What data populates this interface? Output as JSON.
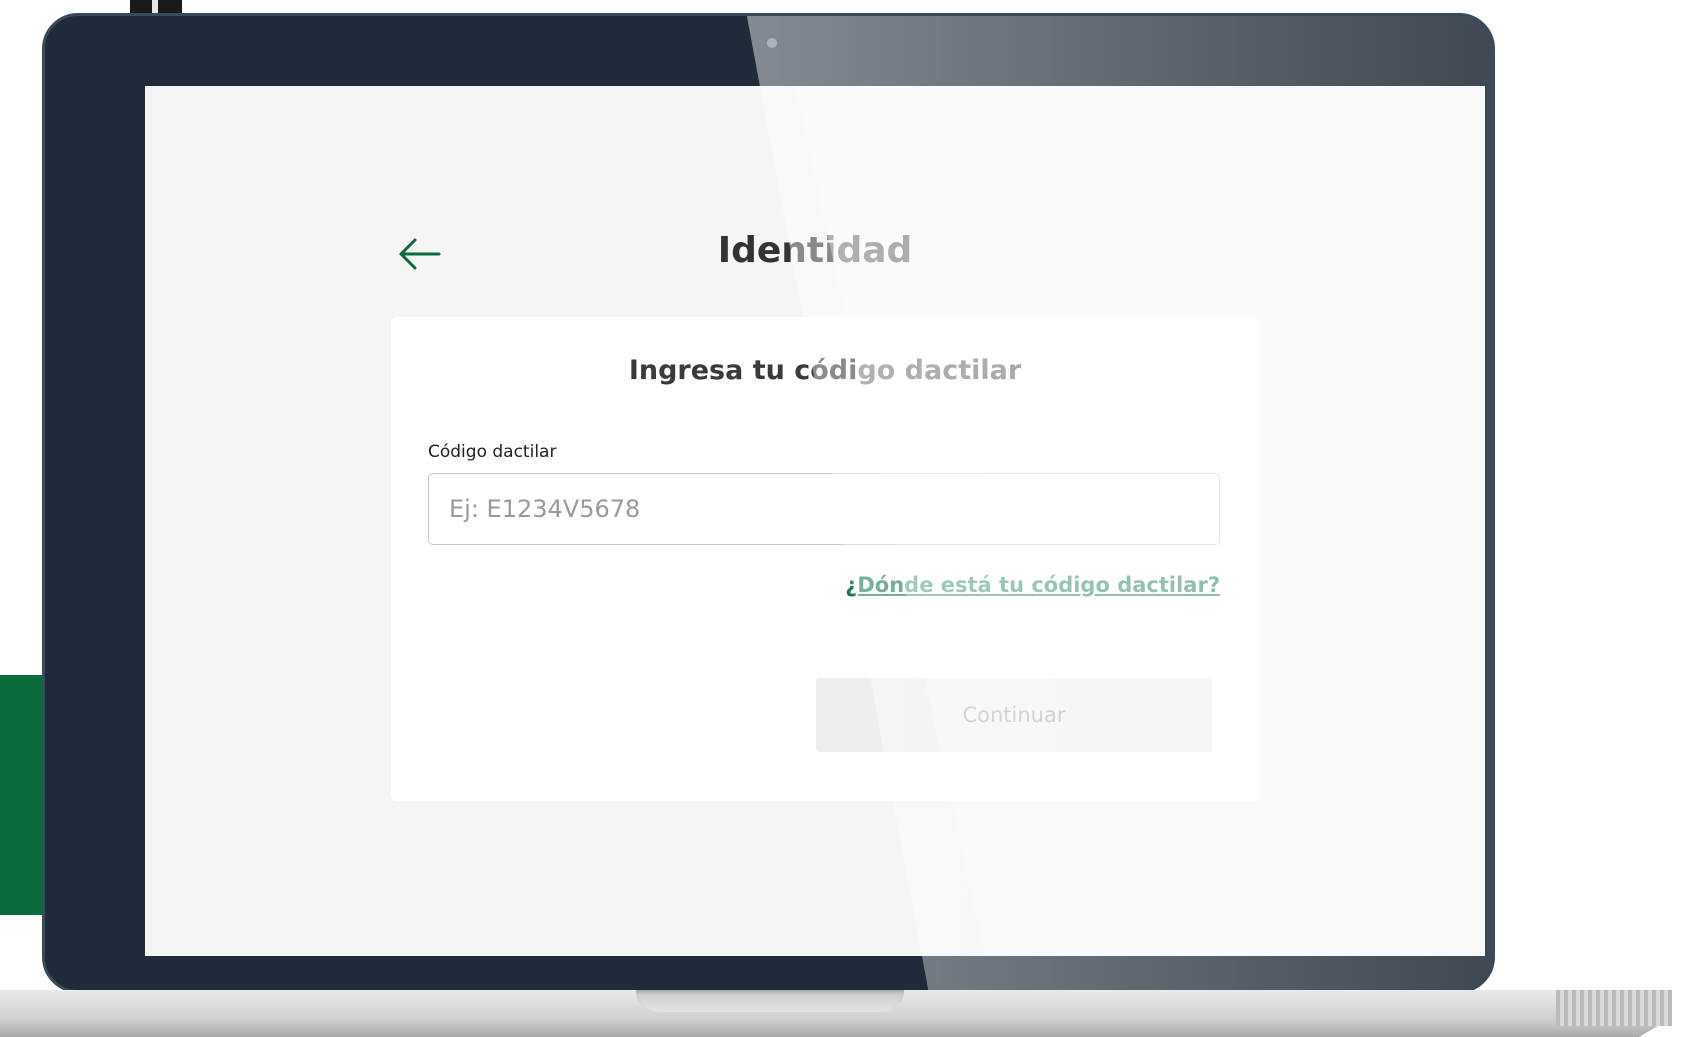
{
  "page": {
    "title": "Identidad",
    "back_icon": "arrow-left-icon"
  },
  "card": {
    "title": "Ingresa tu código dactilar",
    "field_label": "Código dactilar",
    "input_value": "",
    "input_placeholder": "Ej: E1234V5678",
    "help_link": "¿Dónde está tu código dactilar?",
    "continue_label": "Continuar"
  },
  "colors": {
    "accent_green": "#0b6b3d",
    "link_green": "#1a7a55",
    "bezel": "#1f2b38",
    "screen_bg": "#f5f5f5",
    "button_disabled_bg": "#eeeeee",
    "button_disabled_text": "#9a9a9a"
  }
}
